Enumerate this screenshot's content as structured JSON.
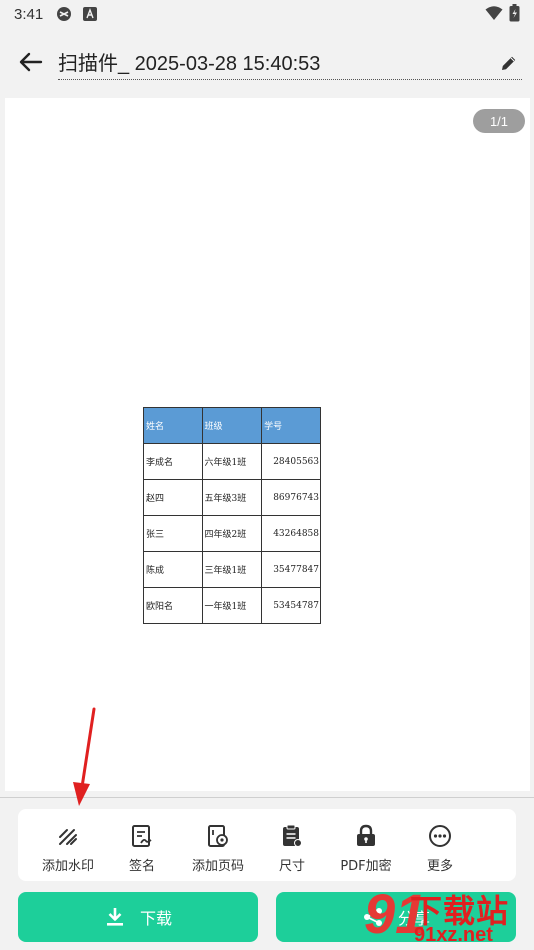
{
  "status_bar": {
    "time": "3:41",
    "icons": [
      "game-icon",
      "a-icon",
      "wifi-icon",
      "battery-icon"
    ]
  },
  "header": {
    "title": "扫描件_ 2025-03-28 15:40:53",
    "back_icon": "back-arrow-icon",
    "edit_icon": "pencil-icon"
  },
  "preview": {
    "page_indicator": "1/1",
    "table": {
      "headers": [
        "姓名",
        "班级",
        "学号"
      ],
      "rows": [
        [
          "李成名",
          "六年级1班",
          "28405563"
        ],
        [
          "赵四",
          "五年级3班",
          "86976743"
        ],
        [
          "张三",
          "四年级2班",
          "43264858"
        ],
        [
          "陈成",
          "三年级1班",
          "35477847"
        ],
        [
          "欧阳名",
          "一年级1班",
          "53454787"
        ]
      ],
      "header_color": "#5b9bd5"
    }
  },
  "toolbar": {
    "items": [
      {
        "label": "添加水印",
        "icon": "watermark-icon"
      },
      {
        "label": "签名",
        "icon": "signature-icon"
      },
      {
        "label": "添加页码",
        "icon": "page-number-icon"
      },
      {
        "label": "尺寸",
        "icon": "size-icon"
      },
      {
        "label": "PDF加密",
        "icon": "lock-icon"
      },
      {
        "label": "更多",
        "icon": "more-icon"
      }
    ]
  },
  "actions": {
    "download_label": "下载",
    "share_label": "分享",
    "accent_color": "#1dcf9a"
  },
  "watermark": {
    "big_text": "下载站",
    "url_text": "91xz.net",
    "logo_text": "91"
  }
}
